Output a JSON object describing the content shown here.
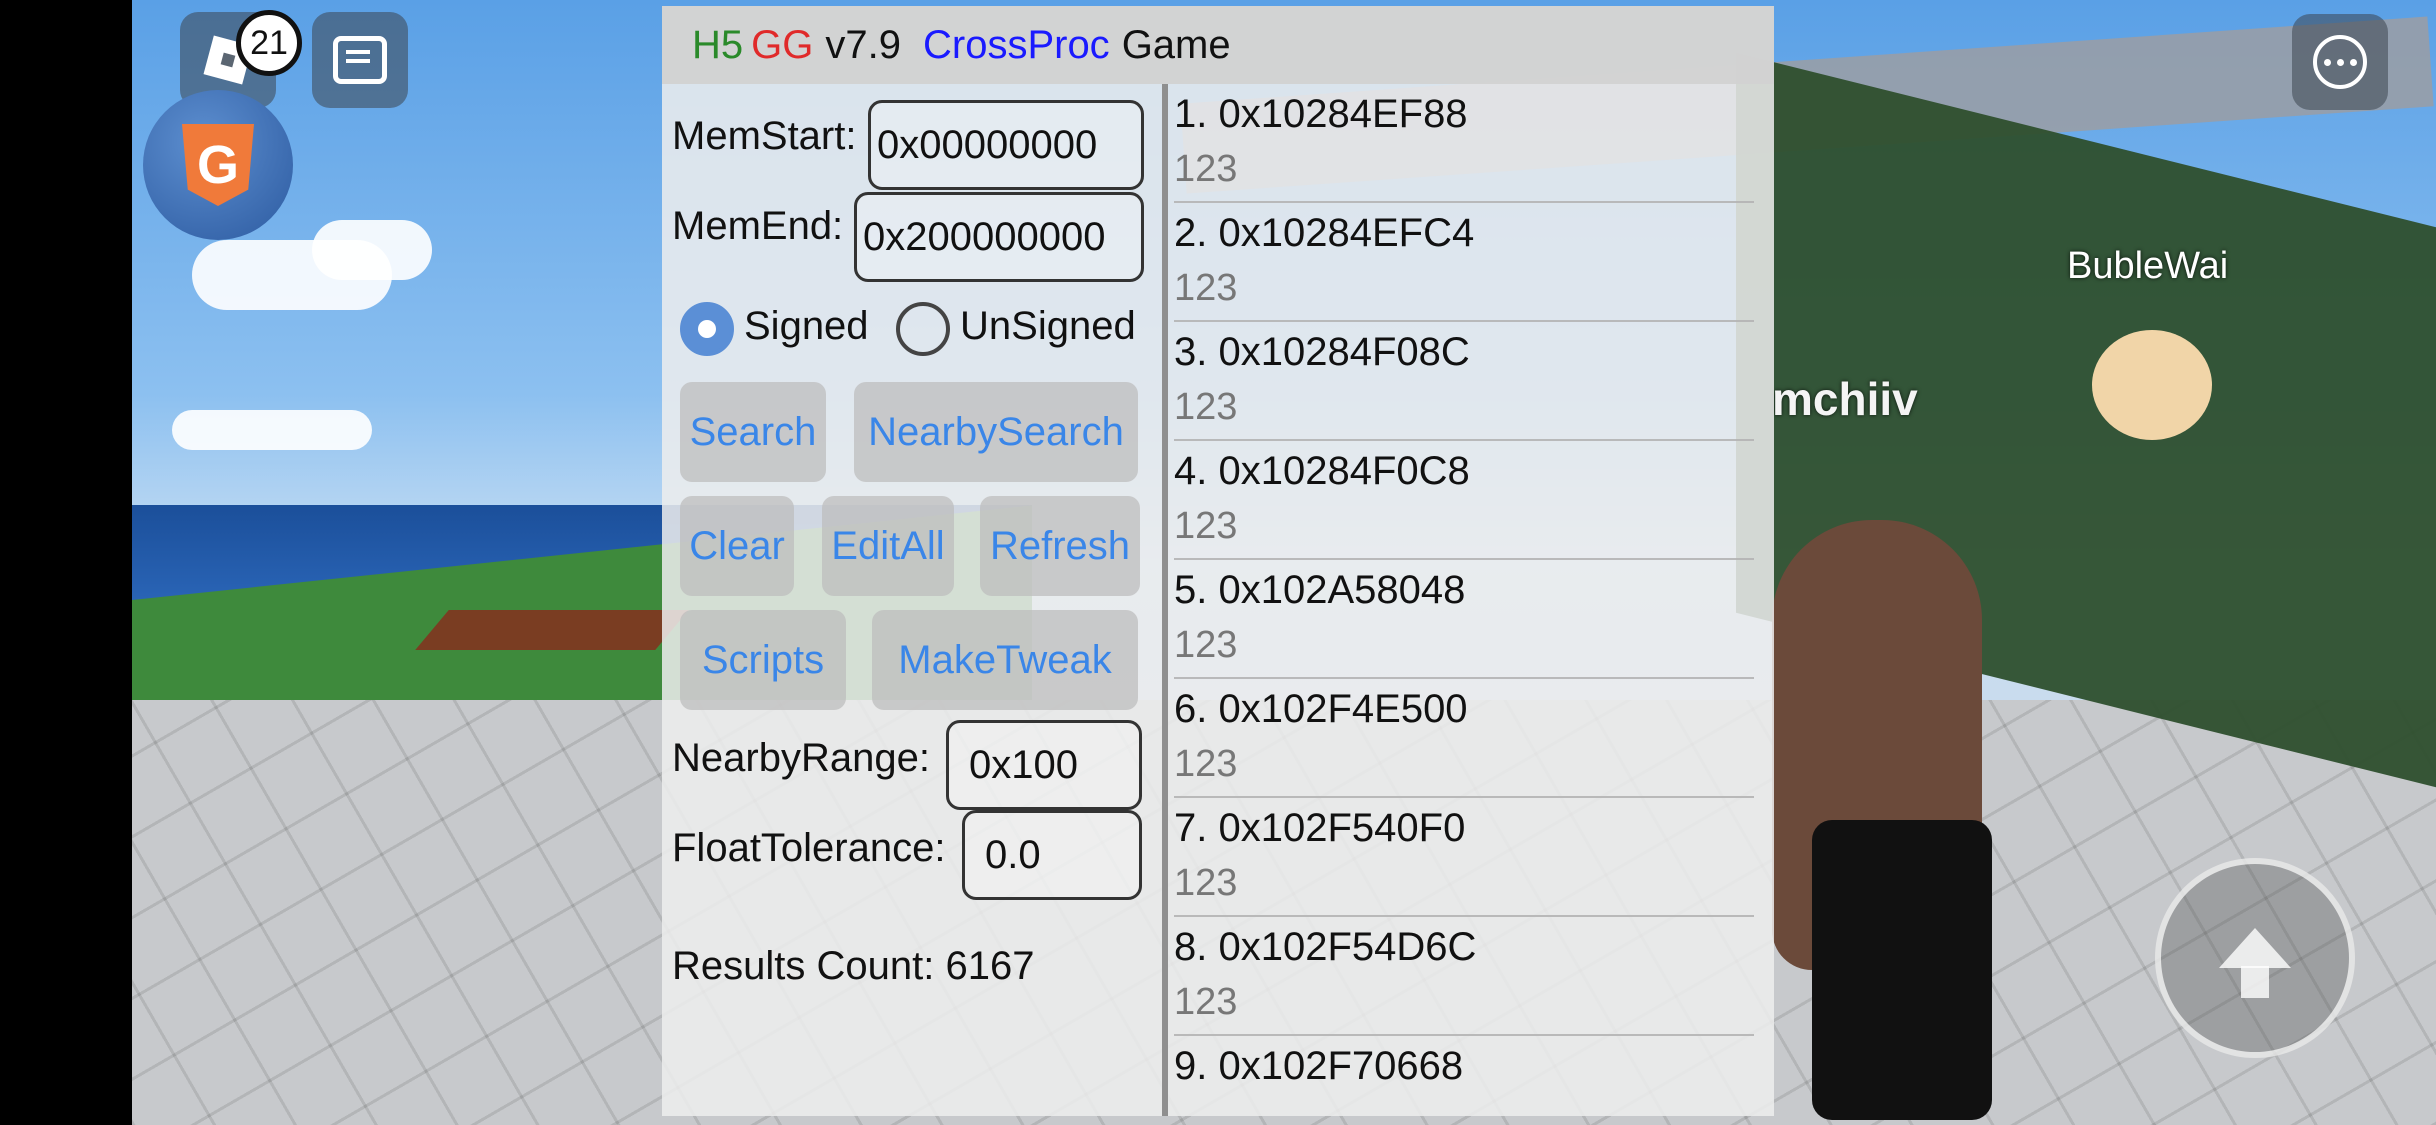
{
  "panel": {
    "title_h5": "H5",
    "title_gg": "GG",
    "title_version": "v7.9",
    "title_crossproc": "CrossProc",
    "title_game": "Game",
    "memstart_label": "MemStart:",
    "memstart_value": "0x00000000",
    "memend_label": "MemEnd:",
    "memend_value": "0x200000000",
    "signed_label": "Signed",
    "unsigned_label": "UnSigned",
    "signed_selected": true,
    "buttons": {
      "search": "Search",
      "nearby_search": "NearbySearch",
      "clear": "Clear",
      "edit_all": "EditAll",
      "refresh": "Refresh",
      "scripts": "Scripts",
      "make_tweak": "MakeTweak"
    },
    "nearby_range_label": "NearbyRange:",
    "nearby_range_value": "0x100",
    "float_tolerance_label": "FloatTolerance:",
    "float_tolerance_value": "0.0",
    "results_count_text": "Results Count: 6167"
  },
  "results": [
    {
      "addr": "1. 0x10284EF88",
      "value": "123"
    },
    {
      "addr": "2. 0x10284EFC4",
      "value": "123"
    },
    {
      "addr": "3. 0x10284F08C",
      "value": "123"
    },
    {
      "addr": "4. 0x10284F0C8",
      "value": "123"
    },
    {
      "addr": "5. 0x102A58048",
      "value": "123"
    },
    {
      "addr": "6. 0x102F4E500",
      "value": "123"
    },
    {
      "addr": "7. 0x102F540F0",
      "value": "123"
    },
    {
      "addr": "8. 0x102F54D6C",
      "value": "123"
    },
    {
      "addr": "9. 0x102F70668",
      "value": ""
    }
  ],
  "game": {
    "chat_badge_count": "21",
    "player_name_1": "BubleWai",
    "player_name_2": "mchiiv",
    "gg_icon_letter": "G"
  },
  "icons": [
    "roblox-menu-icon",
    "chat-icon",
    "h5gg-float-icon",
    "more-options-icon",
    "jump-icon"
  ]
}
